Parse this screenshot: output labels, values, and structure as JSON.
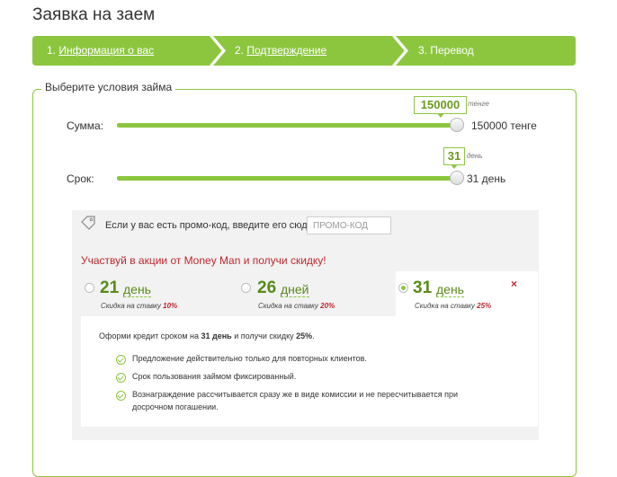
{
  "page": {
    "title": "Заявка на заем"
  },
  "steps": [
    {
      "prefix": "1. ",
      "label": "Информация о вас"
    },
    {
      "prefix": "2. ",
      "label": "Подтверждение"
    },
    {
      "prefix": "",
      "label": "3. Перевод"
    }
  ],
  "colors": {
    "accent": "#8cc63f",
    "accent_dark": "#6a9a1f",
    "alert": "#c0272d",
    "panel": "#f2f2f2"
  },
  "form": {
    "legend": "Выберите условия займа",
    "amount": {
      "label": "Сумма:",
      "bubble": "150000",
      "unit_small": "тенге",
      "value_text": "150000 тенге",
      "fill_fraction": 1.0
    },
    "term": {
      "label": "Срок:",
      "bubble": "31",
      "unit_small": "день",
      "value_text": "31 день",
      "fill_fraction": 1.0
    }
  },
  "promo": {
    "icon": "tag-icon",
    "text": "Если у вас есть промо-код, введите его сюда:",
    "placeholder": "ПРОМО-КОД"
  },
  "offer": {
    "title": "Участвуй в акции от Money Man и получи скидку!",
    "options": [
      {
        "num": "21",
        "unit": "день",
        "sub_prefix": "Скидка на ставку",
        "discount": "10%",
        "selected": false
      },
      {
        "num": "26",
        "unit": "дней",
        "sub_prefix": "Скидка на ставку",
        "discount": "20%",
        "selected": false
      },
      {
        "num": "31",
        "unit": "день",
        "sub_prefix": "Скидка на ставку",
        "discount": "25%",
        "selected": true
      }
    ],
    "close": "×",
    "detail": {
      "intro_a": "Оформи кредит сроком на ",
      "intro_b": "31 день",
      "intro_c": " и получи скидку ",
      "intro_d": "25%",
      "intro_e": ".",
      "bullets": [
        "Предложение действительно только для повторных клиентов.",
        "Срок пользования займом фиксированный.",
        "Вознаграждение рассчитывается сразу же в виде комиссии и не пересчитывается при досрочном погашении."
      ]
    }
  }
}
